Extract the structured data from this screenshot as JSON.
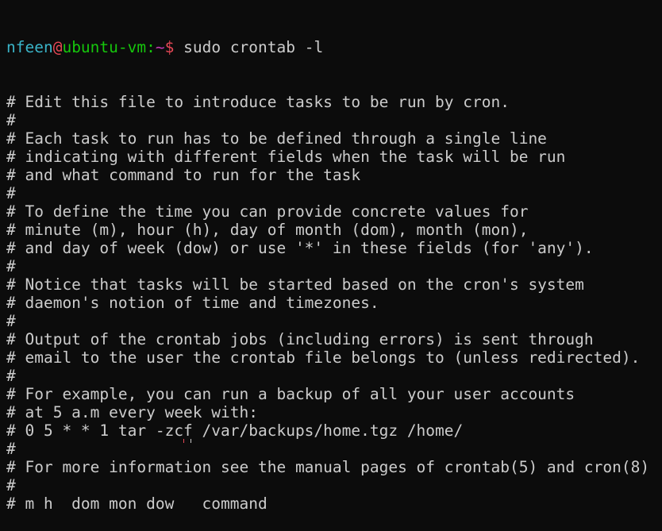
{
  "prompt": {
    "user": "nfeen",
    "at": "@",
    "host": "ubuntu-vm",
    "colon": ":",
    "path": "~",
    "symbol": "$",
    "command": " sudo crontab -l"
  },
  "colors": {
    "background": "#0c0c0c",
    "text": "#cccccc",
    "user": "#3ab4c8",
    "host": "#16c60c",
    "path": "#c239b3",
    "symbol": "#e74856"
  },
  "output_lines": [
    "# Edit this file to introduce tasks to be run by cron.",
    "#",
    "# Each task to run has to be defined through a single line",
    "# indicating with different fields when the task will be run",
    "# and what command to run for the task",
    "#",
    "# To define the time you can provide concrete values for",
    "# minute (m), hour (h), day of month (dom), month (mon),",
    "# and day of week (dow) or use '*' in these fields (for 'any').",
    "#",
    "# Notice that tasks will be started based on the cron's system",
    "# daemon's notion of time and timezones.",
    "#",
    "# Output of the crontab jobs (including errors) is sent through",
    "# email to the user the crontab file belongs to (unless redirected).",
    "#",
    "# For example, you can run a backup of all your user accounts",
    "# at 5 a.m every week with:",
    "# 0 5 * * 1 tar -zcf /var/backups/home.tgz /home/",
    "#",
    "# For more information see the manual pages of crontab(5) and cron(8)",
    "#",
    "# m h  dom mon dow   command"
  ]
}
